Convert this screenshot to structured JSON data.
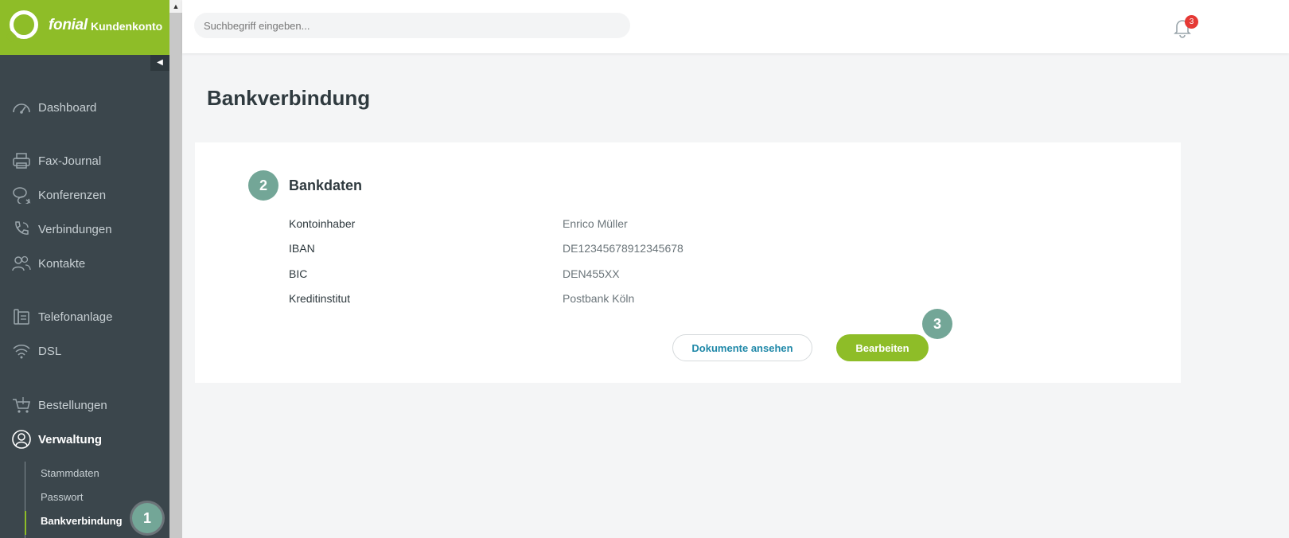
{
  "brand": {
    "name": "fonial",
    "subtitle": "Kundenkonto"
  },
  "sidebar": {
    "items": [
      {
        "label": "Dashboard",
        "icon": "speedometer-icon"
      },
      {
        "label": "Fax-Journal",
        "icon": "printer-icon"
      },
      {
        "label": "Konferenzen",
        "icon": "chat-bubbles-icon"
      },
      {
        "label": "Verbindungen",
        "icon": "phone-icon"
      },
      {
        "label": "Kontakte",
        "icon": "people-icon"
      },
      {
        "label": "Telefonanlage",
        "icon": "desk-phone-icon"
      },
      {
        "label": "DSL",
        "icon": "wifi-icon"
      },
      {
        "label": "Bestellungen",
        "icon": "cart-icon"
      },
      {
        "label": "Verwaltung",
        "icon": "user-circle-icon",
        "active": true
      }
    ],
    "subitems": [
      {
        "label": "Stammdaten"
      },
      {
        "label": "Passwort"
      },
      {
        "label": "Bankverbindung",
        "active": true
      }
    ]
  },
  "search": {
    "placeholder": "Suchbegriff eingeben..."
  },
  "notifications": {
    "count": "3"
  },
  "page": {
    "title": "Bankverbindung"
  },
  "bankdaten": {
    "title": "Bankdaten",
    "rows": [
      {
        "label": "Kontoinhaber",
        "value": "Enrico Müller"
      },
      {
        "label": "IBAN",
        "value": "DE12345678912345678"
      },
      {
        "label": "BIC",
        "value": "DEN455XX"
      },
      {
        "label": "Kreditinstitut",
        "value": "Postbank Köln"
      }
    ]
  },
  "buttons": {
    "documents": "Dokumente ansehen",
    "edit": "Bearbeiten"
  },
  "steps": {
    "one": "1",
    "two": "2",
    "three": "3"
  },
  "colors": {
    "brand_green": "#8ebd28",
    "sidebar": "#3b464c",
    "step_badge": "#73a697",
    "link_blue": "#1f88a8",
    "alert_red": "#e53935"
  }
}
